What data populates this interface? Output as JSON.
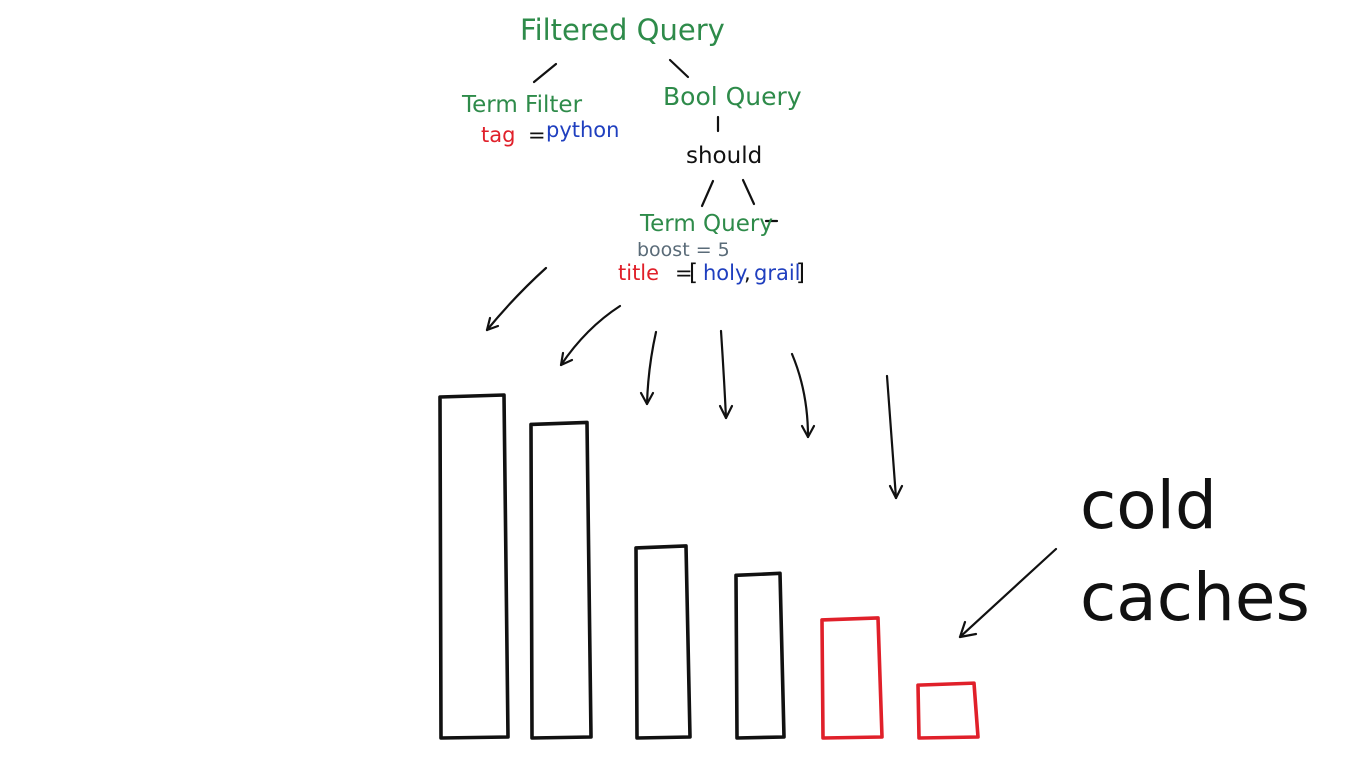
{
  "tree": {
    "root": {
      "label": "Filtered Query"
    },
    "term_filter": {
      "label": "Term Filter",
      "field": "tag",
      "eq": "=",
      "value": "python"
    },
    "bool_query": {
      "label": "Bool Query",
      "clause": "should"
    },
    "term_query": {
      "label": "Term Query",
      "boost": "boost = 5",
      "field": "title",
      "eq": "=",
      "open": "[",
      "value1": "holy",
      "sep": ",",
      "value2": "grail",
      "close": "]"
    }
  },
  "annotation": {
    "line1": "cold",
    "line2": "caches"
  },
  "bars": [
    {
      "level": 1.0,
      "cold": false
    },
    {
      "level": 0.92,
      "cold": false
    },
    {
      "level": 0.56,
      "cold": false
    },
    {
      "level": 0.48,
      "cold": false
    },
    {
      "level": 0.35,
      "cold": true
    },
    {
      "level": 0.16,
      "cold": true
    }
  ],
  "colors": {
    "node": "#2e8b4a",
    "field": "#e0202a",
    "value": "#1f3fbf",
    "cold": "#e0202a",
    "ink": "#111111"
  }
}
